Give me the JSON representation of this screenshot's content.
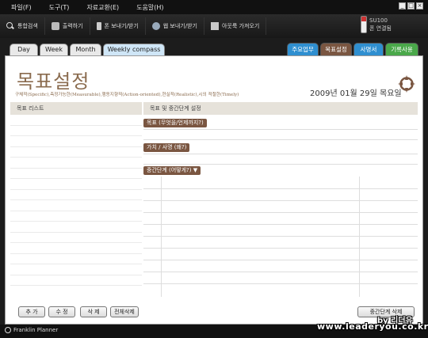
{
  "menubar": {
    "items": [
      {
        "label": "파일(F)"
      },
      {
        "label": "도구(T)"
      },
      {
        "label": "자료교환(E)"
      },
      {
        "label": "도움말(H)"
      }
    ]
  },
  "toolbar": {
    "items": [
      {
        "label": "통합검색",
        "icon": "search-icon"
      },
      {
        "label": "출력하기",
        "icon": "printer-icon"
      },
      {
        "label": "폰 보내기/받기",
        "icon": "phone-icon"
      },
      {
        "label": "웹 보내기/받기",
        "icon": "web-icon"
      },
      {
        "label": "아웃룩 가져오기",
        "icon": "outlook-icon"
      }
    ],
    "device": {
      "name": "SU100",
      "status": "폰 연결됨"
    }
  },
  "tabs": [
    {
      "label": "Day"
    },
    {
      "label": "Week"
    },
    {
      "label": "Month"
    },
    {
      "label": "Weekly compass"
    }
  ],
  "right_tabs": [
    {
      "label": "주요업무",
      "color": "#2f8fd0"
    },
    {
      "label": "목표설정",
      "color": "#7a5641"
    },
    {
      "label": "사명서",
      "color": "#2f8fd0"
    },
    {
      "label": "기록사용",
      "color": "#4aa84a"
    }
  ],
  "page": {
    "title": "목표설정",
    "subtitle": "구체적(Specific),측정가능한(Measurable),행동지향적(Action-oriented),현실적(Realistic),시의 적절한(Timely)",
    "date": "2009년 01월 29일 목요일"
  },
  "left_panel": {
    "header": "목표 리스트",
    "buttons": {
      "add": "추 가",
      "edit": "수 정",
      "delete": "삭 제",
      "delete_all": "전체삭제"
    }
  },
  "right_panel": {
    "header": "목표 및 중간단계 설정",
    "goal_label": "목표 (무엇을/언제까지?)",
    "value_label": "가치 / 사명 (왜?)",
    "steps_label": "중간단계 (어떻게?)",
    "steps_delete_button": "중간단계 삭제"
  },
  "status": {
    "app_name": "Franklin Planner",
    "watermark_name": "by 리더유",
    "watermark_url": "www.leaderyou.co.kr"
  }
}
